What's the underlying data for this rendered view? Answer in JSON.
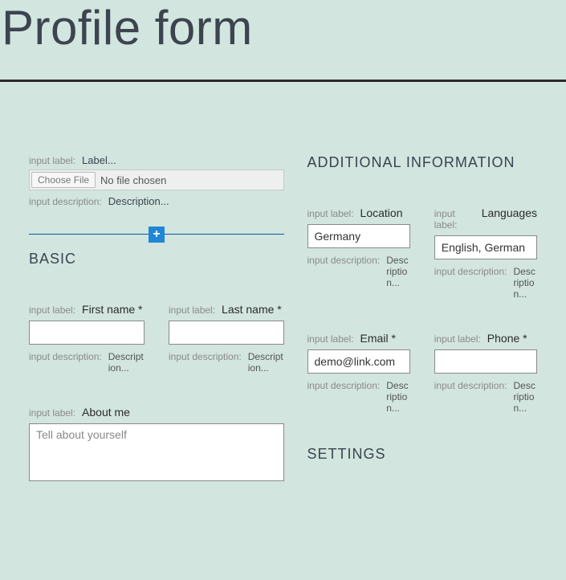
{
  "page_title": "Profile form",
  "meta": {
    "input_label": "input label:",
    "input_description": "input description:",
    "label_placeholder": "Label...",
    "description_placeholder": "Description...",
    "description_trunc": "Description..."
  },
  "file": {
    "button": "Choose File",
    "status": "No file chosen"
  },
  "sections": {
    "basic": "BASIC",
    "additional": "ADDITIONAL INFORMATION",
    "settings": "SETTINGS"
  },
  "fields": {
    "first_name": {
      "label": "First name *",
      "value": ""
    },
    "last_name": {
      "label": "Last name *",
      "value": ""
    },
    "about": {
      "label": "About me",
      "placeholder": "Tell about yourself",
      "value": ""
    },
    "location": {
      "label": "Location",
      "value": "Germany"
    },
    "languages": {
      "label": "Languages",
      "value": "English, German"
    },
    "email": {
      "label": "Email *",
      "value": "demo@link.com"
    },
    "phone": {
      "label": "Phone *",
      "value": ""
    }
  }
}
